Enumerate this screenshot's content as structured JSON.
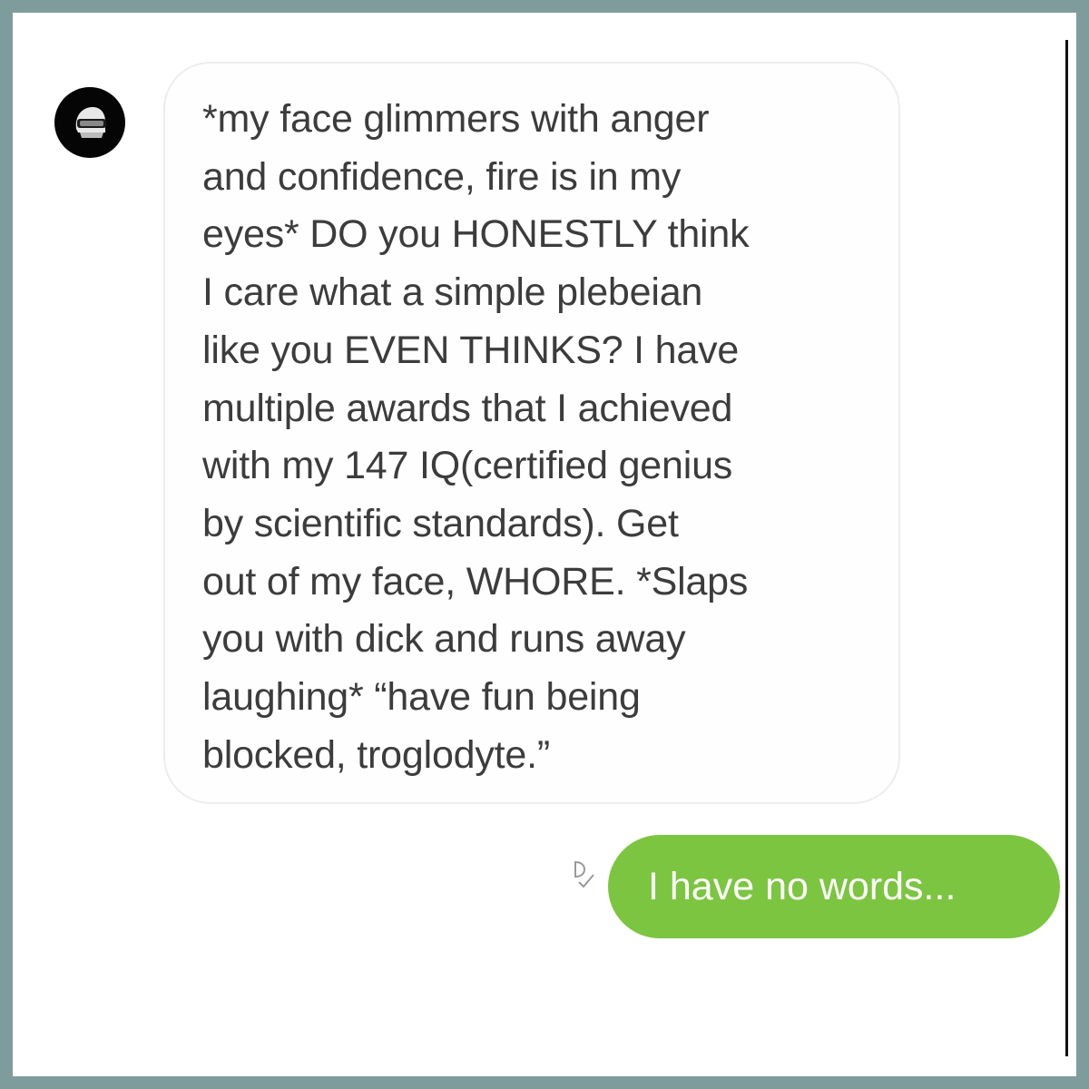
{
  "conversation": {
    "incoming_message": {
      "lines": [
        "*my face glimmers with anger",
        "and confidence, fire is in my",
        "eyes* DO you HONESTLY think",
        "I care what a simple plebeian",
        "like you EVEN THINKS? I have",
        "multiple awards that I achieved",
        "with my 147 IQ(certified genius",
        "by scientific standards). Get",
        "out of my face, WHORE. *Slaps",
        "you with dick and runs away",
        "laughing* “have fun being",
        "blocked, troglodyte.”"
      ],
      "avatar_icon": "helmet-avatar-icon"
    },
    "outgoing_message": {
      "text": "I have no words...",
      "receipt_icon": "delivered-check-icon"
    }
  },
  "colors": {
    "outer_border": "#7f9c9c",
    "outgoing_bubble": "#7cc540",
    "incoming_bubble_border": "#ededed",
    "incoming_text": "#3c3c3c"
  }
}
